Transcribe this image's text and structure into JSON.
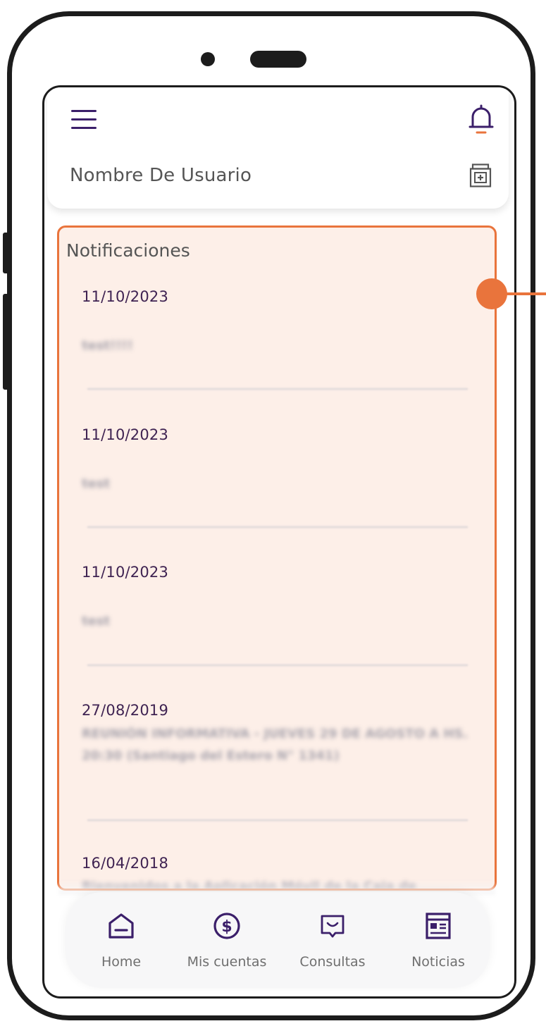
{
  "header": {
    "user_name": "Nombre De Usuario"
  },
  "notifications": {
    "title": "Notificaciones",
    "items": [
      {
        "date": "11/10/2023",
        "text": "test!!!!"
      },
      {
        "date": "11/10/2023",
        "text": "test"
      },
      {
        "date": "11/10/2023",
        "text": "test"
      },
      {
        "date": "27/08/2019",
        "text": "REUNIÓN INFORMATIVA - JUEVES 29 DE AGOSTO A HS. 20:30 (Santiago del Estero N° 1341)"
      },
      {
        "date": "16/04/2018",
        "text": "Bienvenidos a la Aplicación Móvil de la Caja de"
      }
    ]
  },
  "bottom_nav": {
    "items": [
      {
        "label": "Home",
        "icon": "home-icon"
      },
      {
        "label": "Mis cuentas",
        "icon": "dollar-circle-icon"
      },
      {
        "label": "Consultas",
        "icon": "chat-icon"
      },
      {
        "label": "Noticias",
        "icon": "newspaper-icon"
      }
    ]
  },
  "colors": {
    "accent": "#3b1f6a",
    "highlight": "#e9743c",
    "panel_bg": "#fdefe8"
  }
}
